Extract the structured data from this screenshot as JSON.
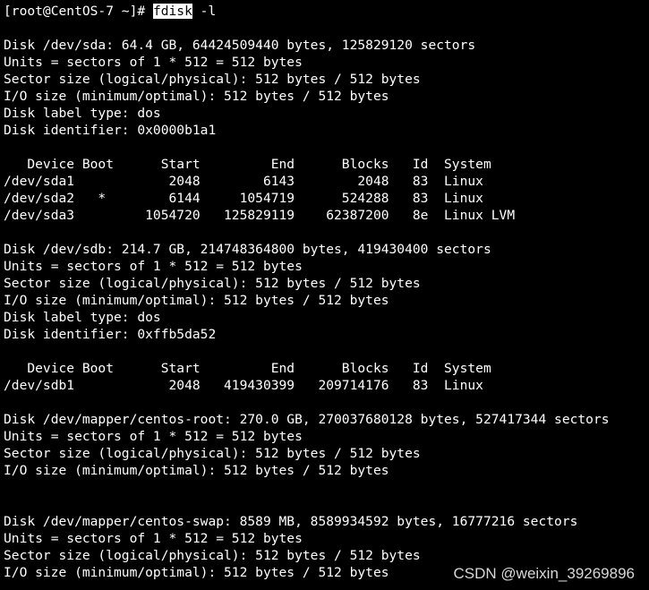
{
  "terminal": {
    "prompt": "[root@CentOS-7 ~]# ",
    "command": "fdisk",
    "args": " -l",
    "output": [
      "",
      "Disk /dev/sda: 64.4 GB, 64424509440 bytes, 125829120 sectors",
      "Units = sectors of 1 * 512 = 512 bytes",
      "Sector size (logical/physical): 512 bytes / 512 bytes",
      "I/O size (minimum/optimal): 512 bytes / 512 bytes",
      "Disk label type: dos",
      "Disk identifier: 0x0000b1a1",
      "",
      "   Device Boot      Start         End      Blocks   Id  System",
      "/dev/sda1            2048        6143        2048   83  Linux",
      "/dev/sda2   *        6144     1054719      524288   83  Linux",
      "/dev/sda3         1054720   125829119    62387200   8e  Linux LVM",
      "",
      "Disk /dev/sdb: 214.7 GB, 214748364800 bytes, 419430400 sectors",
      "Units = sectors of 1 * 512 = 512 bytes",
      "Sector size (logical/physical): 512 bytes / 512 bytes",
      "I/O size (minimum/optimal): 512 bytes / 512 bytes",
      "Disk label type: dos",
      "Disk identifier: 0xffb5da52",
      "",
      "   Device Boot      Start         End      Blocks   Id  System",
      "/dev/sdb1            2048   419430399   209714176   83  Linux",
      "",
      "Disk /dev/mapper/centos-root: 270.0 GB, 270037680128 bytes, 527417344 sectors",
      "Units = sectors of 1 * 512 = 512 bytes",
      "Sector size (logical/physical): 512 bytes / 512 bytes",
      "I/O size (minimum/optimal): 512 bytes / 512 bytes",
      "",
      "",
      "Disk /dev/mapper/centos-swap: 8589 MB, 8589934592 bytes, 16777216 sectors",
      "Units = sectors of 1 * 512 = 512 bytes",
      "Sector size (logical/physical): 512 bytes / 512 bytes",
      "I/O size (minimum/optimal): 512 bytes / 512 bytes"
    ]
  },
  "watermark": "CSDN @weixin_39269896",
  "colors": {
    "background": "#000000",
    "text": "#ffffff",
    "selection_bg": "#ffffff",
    "selection_fg": "#000000"
  }
}
